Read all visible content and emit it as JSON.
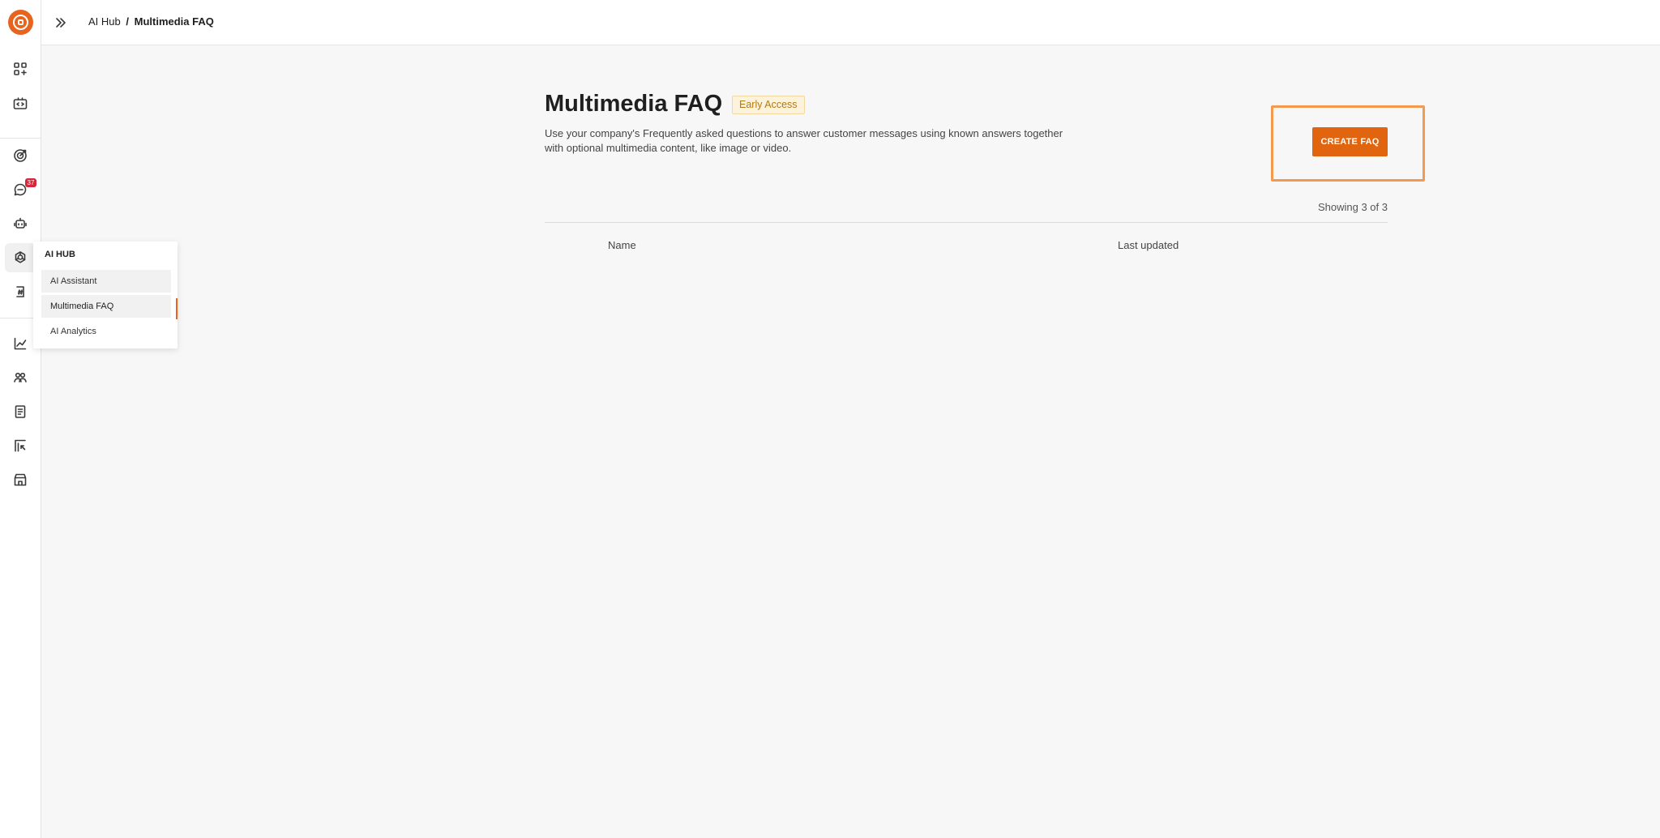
{
  "breadcrumb": {
    "parent": "AI Hub",
    "separator": "/",
    "current": "Multimedia FAQ"
  },
  "rail": {
    "badge_count": "37",
    "icons": [
      "apps-icon",
      "code-icon",
      "target-icon",
      "chat-icon",
      "bot-icon",
      "ai-hub-icon",
      "channel-icon",
      "analytics-chart-icon",
      "people-icon",
      "document-icon",
      "board-icon",
      "store-icon"
    ]
  },
  "flyout": {
    "title": "AI HUB",
    "items": [
      {
        "label": "AI Assistant"
      },
      {
        "label": "Multimedia FAQ"
      },
      {
        "label": "AI Analytics"
      }
    ]
  },
  "main": {
    "title": "Multimedia FAQ",
    "badge": "Early Access",
    "description": "Use your company's Frequently asked questions to answer customer messages using known answers together with optional multimedia content, like image or video.",
    "create_button": "CREATE FAQ",
    "showing": "Showing 3 of 3",
    "columns": [
      "Name",
      "Last updated"
    ]
  },
  "colors": {
    "accent": "#e1640f",
    "highlight": "#f39a4f",
    "badge_bg": "#fdf3dc",
    "badge_text": "#b07a12"
  }
}
